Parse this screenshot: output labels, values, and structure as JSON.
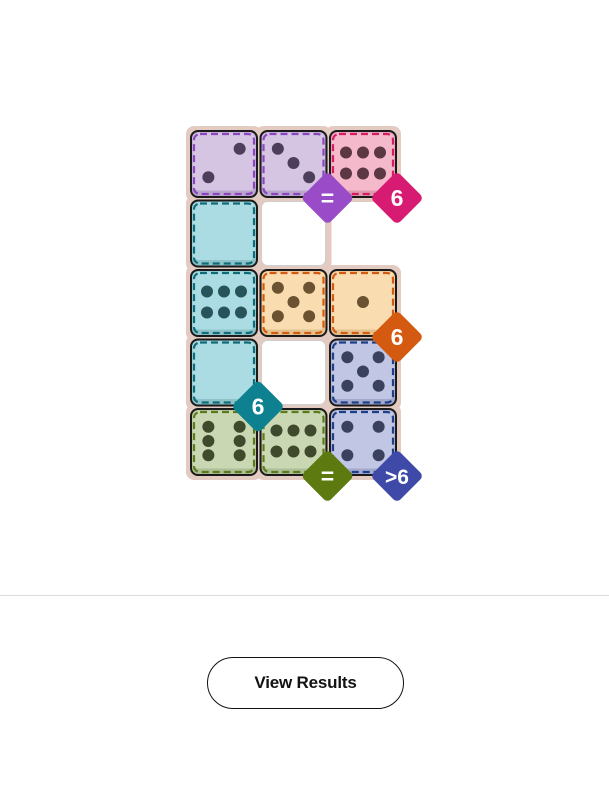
{
  "board": {
    "cells": [
      {
        "row": 0,
        "col": 0,
        "pips": 2,
        "region": "purple"
      },
      {
        "row": 0,
        "col": 1,
        "pips": 3,
        "region": "purple"
      },
      {
        "row": 0,
        "col": 2,
        "pips": 6,
        "region": "pink"
      },
      {
        "row": 1,
        "col": 0,
        "pips": 0,
        "region": "teal"
      },
      {
        "row": 2,
        "col": 0,
        "pips": 6,
        "region": "teal"
      },
      {
        "row": 2,
        "col": 1,
        "pips": 5,
        "region": "orange"
      },
      {
        "row": 2,
        "col": 2,
        "pips": 1,
        "region": "orange"
      },
      {
        "row": 3,
        "col": 0,
        "pips": 0,
        "region": "teal"
      },
      {
        "row": 3,
        "col": 2,
        "pips": 5,
        "region": "navy"
      },
      {
        "row": 4,
        "col": 0,
        "pips": 6,
        "region": "green"
      },
      {
        "row": 4,
        "col": 1,
        "pips": 6,
        "region": "green"
      },
      {
        "row": 4,
        "col": 2,
        "pips": 4,
        "region": "navy"
      }
    ],
    "empty_cells": [
      {
        "row": 1,
        "col": 1
      },
      {
        "row": 3,
        "col": 1
      }
    ],
    "region_colors": {
      "purple": {
        "fill": "#d5c5e3",
        "shade": "#b9a7cc",
        "border": "#8b45c1",
        "pip": "#4d3f5c"
      },
      "pink": {
        "fill": "#f4b9ca",
        "shade": "#dc9bae",
        "border": "#d81b60",
        "pip": "#5c3845"
      },
      "teal": {
        "fill": "#acdce3",
        "shade": "#8ec2c9",
        "border": "#0e6b78",
        "pip": "#27545b"
      },
      "orange": {
        "fill": "#f9dcb0",
        "shade": "#e4c28f",
        "border": "#d35a10",
        "pip": "#6b5230"
      },
      "navy": {
        "fill": "#c0c6e3",
        "shade": "#a2a9cc",
        "border": "#1d3f8a",
        "pip": "#3a415e"
      },
      "green": {
        "fill": "#c9d8b2",
        "shade": "#adbe95",
        "border": "#5c7a1c",
        "pip": "#3f4a2c"
      }
    },
    "constraints": [
      {
        "row": 0,
        "col": 1,
        "label": "=",
        "color": "#9a4cc8",
        "region": "purple"
      },
      {
        "row": 0,
        "col": 2,
        "label": "6",
        "color": "#d81b72",
        "region": "pink"
      },
      {
        "row": 2,
        "col": 2,
        "label": "6",
        "color": "#d35a10",
        "region": "orange"
      },
      {
        "row": 3,
        "col": 0,
        "label": "6",
        "color": "#0e8190",
        "region": "teal"
      },
      {
        "row": 4,
        "col": 1,
        "label": "=",
        "color": "#5c7a10",
        "region": "green"
      },
      {
        "row": 4,
        "col": 2,
        "label": ">6",
        "color": "#3f4aa8",
        "region": "navy"
      }
    ],
    "frame_color": "#e3cbc1",
    "dice_outline": "#1a1a1a"
  },
  "actions": {
    "view_results_label": "View Results"
  }
}
